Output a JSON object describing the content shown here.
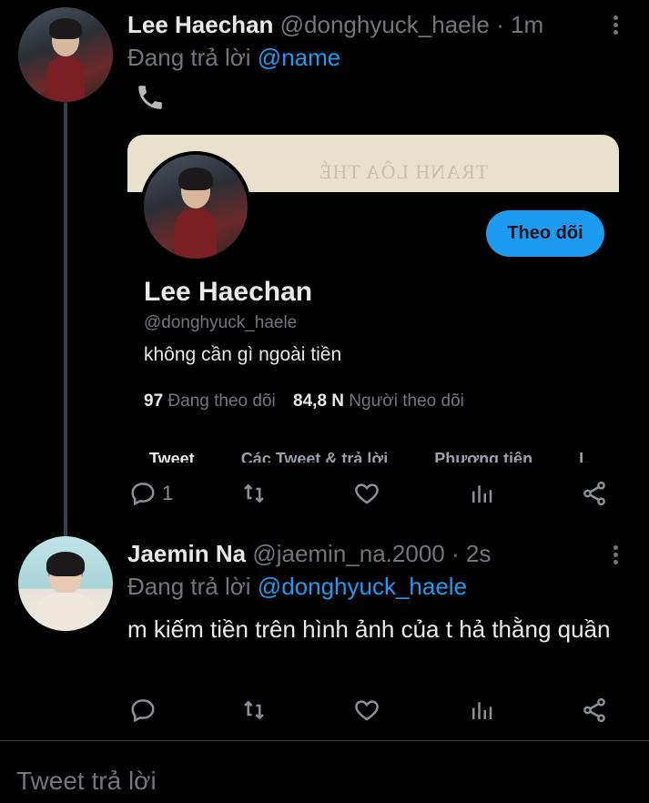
{
  "tweet1": {
    "name": "Lee Haechan",
    "handle": "@donghyuck_haele",
    "time": "· 1m",
    "replying_prefix": "Đang trả lời",
    "replying_to": "@name",
    "phone_icon": "phone-icon",
    "reply_count": "1"
  },
  "profile_card": {
    "banner_text": "TRANH LÔA THÉ",
    "name": "Lee Haechan",
    "handle": "@donghyuck_haele",
    "bio": "không cần gì ngoài tiền",
    "following_count": "97",
    "following_label": "Đang theo dõi",
    "followers_count": "84,8 N",
    "followers_label": "Người theo dõi",
    "follow_button": "Theo dõi",
    "tabs": [
      "Tweet",
      "Các Tweet & trả lời",
      "Phương tiện",
      "L"
    ]
  },
  "tweet2": {
    "name": "Jaemin Na",
    "handle": "@jaemin_na.2000",
    "time": "· 2s",
    "replying_prefix": "Đang trả lời",
    "replying_to": "@donghyuck_haele",
    "text": "m kiếm tiền trên hình ảnh của t hả thằng quần"
  },
  "composer": {
    "placeholder": "Tweet trả lời"
  },
  "colors": {
    "background": "#000000",
    "accent": "#1d9bf0",
    "muted": "#71767b"
  }
}
